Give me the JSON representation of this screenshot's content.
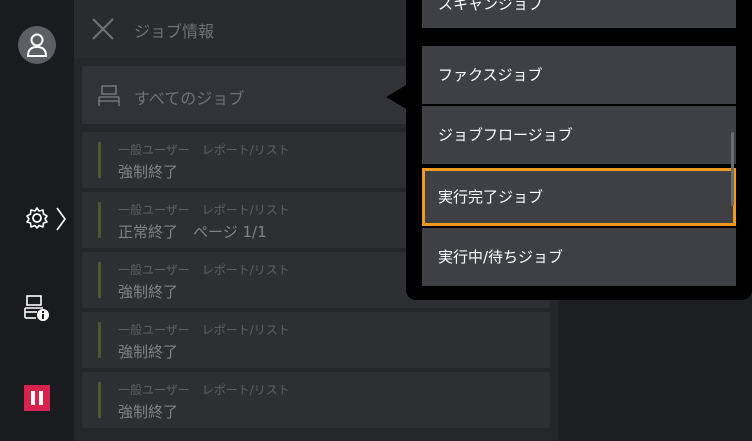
{
  "header": {
    "title": "ジョブ情報"
  },
  "filter": {
    "label": "すべてのジョブ"
  },
  "jobs": [
    {
      "meta": "一般ユーザー　レポート/リスト",
      "status": "強制終了"
    },
    {
      "meta": "一般ユーザー　レポート/リスト",
      "status": "正常終了　ページ 1/1"
    },
    {
      "meta": "一般ユーザー　レポート/リスト",
      "status": "強制終了"
    },
    {
      "meta": "一般ユーザー　レポート/リスト",
      "status": "強制終了"
    },
    {
      "meta": "一般ユーザー　レポート/リスト",
      "status": "強制終了"
    }
  ],
  "menu": {
    "items": [
      {
        "label": "スキャンジョブ"
      },
      {
        "label": "ファクスジョブ"
      },
      {
        "label": "ジョブフロージョブ"
      },
      {
        "label": "実行完了ジョブ",
        "selected": true
      },
      {
        "label": "実行中/待ちジョブ"
      }
    ]
  },
  "colors": {
    "accent": "#f09a1e",
    "stop": "#d8234f",
    "job_bar": "#4d5a2f"
  },
  "icons": [
    "user-icon",
    "gear-icon",
    "chevron-right-icon",
    "printer-info-icon",
    "stop-icon",
    "close-icon",
    "printer-icon"
  ]
}
